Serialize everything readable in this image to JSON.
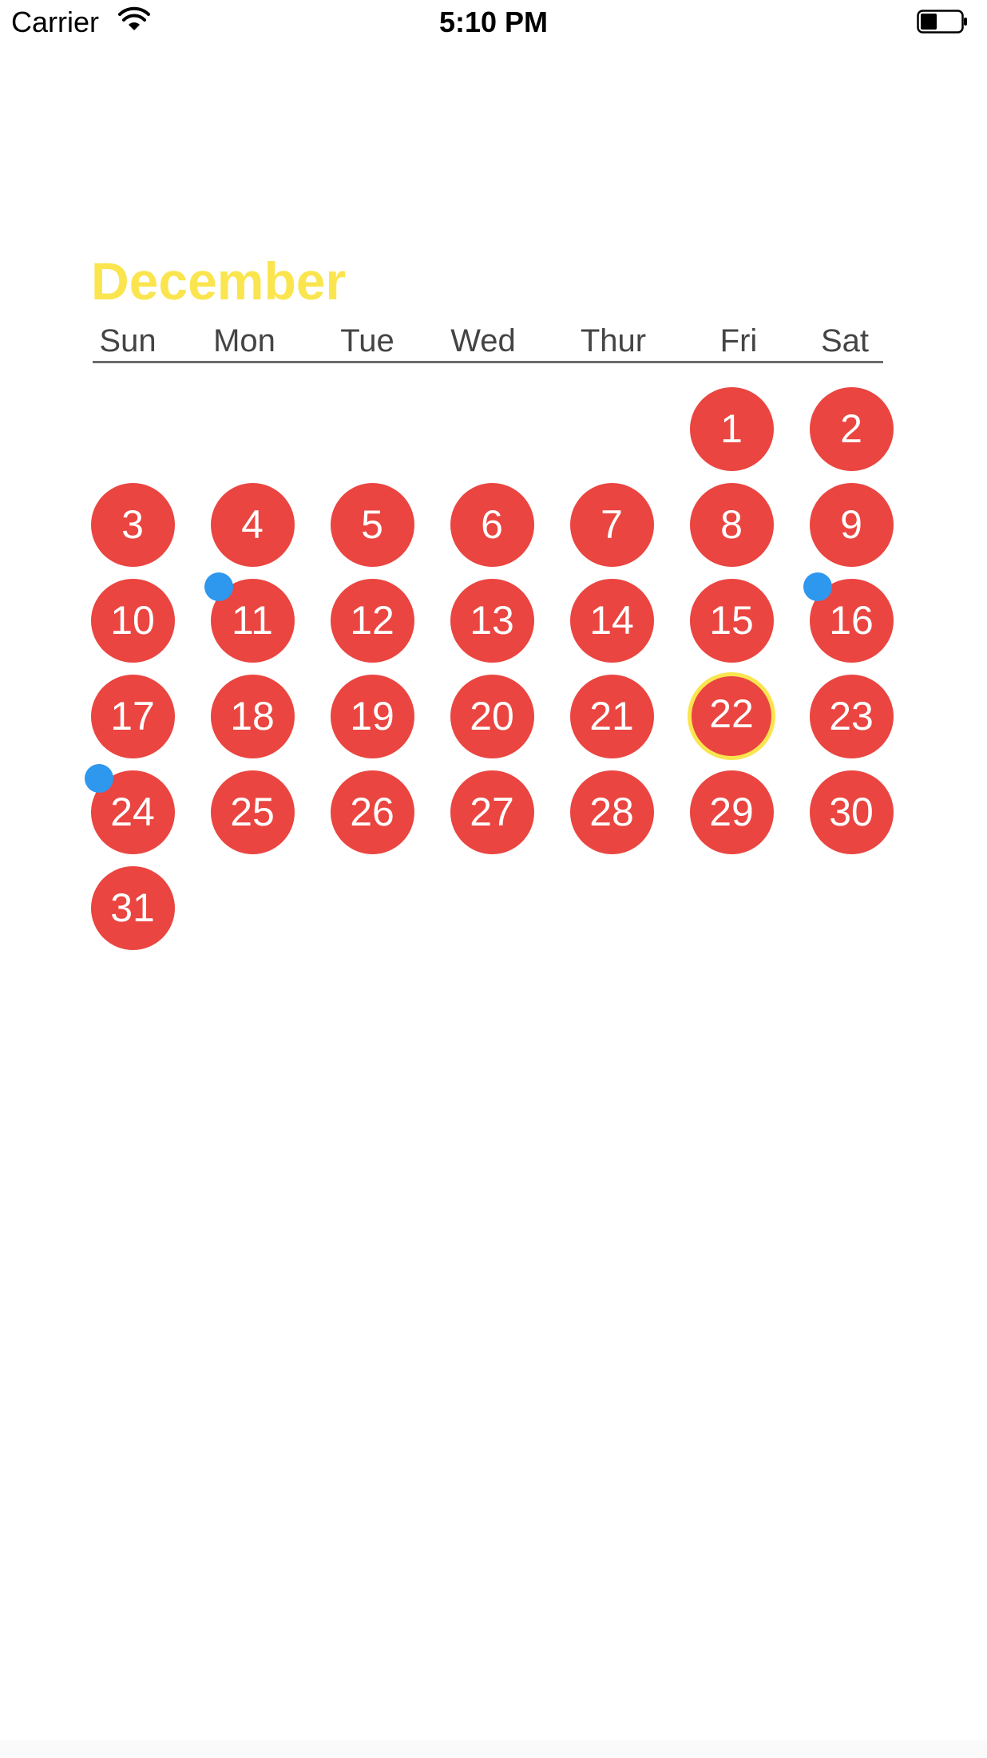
{
  "status_bar": {
    "carrier": "Carrier",
    "time": "5:10 PM",
    "icons": [
      "wifi-icon",
      "battery-icon"
    ]
  },
  "calendar": {
    "month": "December",
    "weekdays": [
      "Sun",
      "Mon",
      "Tue",
      "Wed",
      "Thur",
      "Fri",
      "Sat"
    ],
    "first_weekday_index": 5,
    "days_in_month": 31,
    "day_labels": [
      "1",
      "2",
      "3",
      "4",
      "5",
      "6",
      "7",
      "8",
      "9",
      "10",
      "11",
      "12",
      "13",
      "14",
      "15",
      "16",
      "17",
      "18",
      "19",
      "20",
      "21",
      "22",
      "23",
      "24",
      "25",
      "26",
      "27",
      "28",
      "29",
      "30",
      "31"
    ],
    "selected_day": "22",
    "event_days": [
      "11",
      "16",
      "24"
    ],
    "colors": {
      "title": "#fae54f",
      "day_fill": "#ea4540",
      "day_text": "#ffffff",
      "today_ring": "#fae54f",
      "event_dot": "#2e97ee",
      "weekday_text": "#444444",
      "divider": "#6b6b6b"
    }
  }
}
